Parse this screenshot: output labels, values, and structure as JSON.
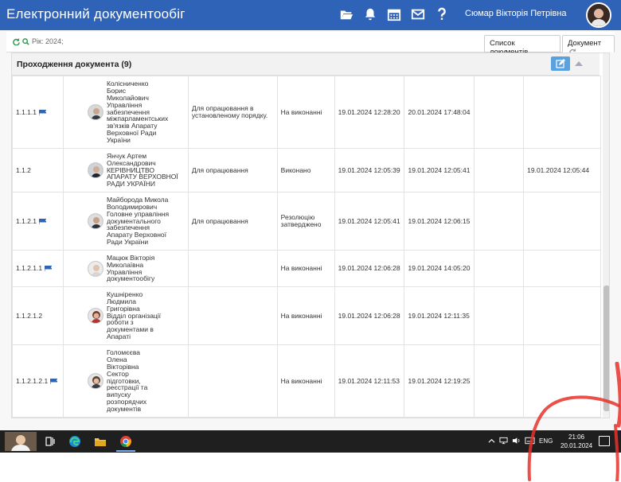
{
  "app": {
    "title": "Електронний документообіг",
    "user_name": "Сюмар Вікторія Петрівна",
    "icons": [
      "folder-open-icon",
      "bell-icon",
      "calendar-icon",
      "envelope-icon",
      "question-icon"
    ]
  },
  "toolbar": {
    "year_filter": "Рік: 2024;",
    "tabs": [
      {
        "label": "Список документів"
      },
      {
        "label": "Документ"
      }
    ]
  },
  "panel": {
    "title": "Проходження документа (9)",
    "rows": [
      {
        "num": "1.1.1.1",
        "flag": true,
        "person": "Колісниченко\nБорис\nМиколайович\nУправління\nзабезпечення\nміжпарламентських\nзв'язків Апарату\nВерховної Ради\nУкраїни",
        "resolution": "Для опрацювання в установленому порядку.",
        "status": "На виконанні",
        "date1": "19.01.2024 12:28:20",
        "date2": "20.01.2024 17:48:04",
        "date3": "",
        "date4": ""
      },
      {
        "num": "1.1.2",
        "flag": false,
        "person": "Янчук Артем\nОлександрович\nКЕРІВНИЦТВО\nАПАРАТУ ВЕРХОВНОЇ\nРАДИ УКРАЇНИ",
        "resolution": "Для опрацювання",
        "status": "Виконано",
        "date1": "19.01.2024 12:05:39",
        "date2": "19.01.2024 12:05:41",
        "date3": "",
        "date4": "19.01.2024 12:05:44"
      },
      {
        "num": "1.1.2.1",
        "flag": true,
        "person": "Майборода Микола\nВолодимирович\nГоловне управління\nдокументального\nзабезпечення\nАпарату Верховної\nРади України",
        "resolution": "Для опрацювання",
        "status": "Резолюцію затверджено",
        "date1": "19.01.2024 12:05:41",
        "date2": "19.01.2024 12:06:15",
        "date3": "",
        "date4": ""
      },
      {
        "num": "1.1.2.1.1",
        "flag": true,
        "person": "Мацюк Вікторія\nМиколаївна\nУправління\nдокументообігу",
        "resolution": "",
        "status": "На виконанні",
        "date1": "19.01.2024 12:06:28",
        "date2": "19.01.2024 14:05:20",
        "date3": "",
        "date4": ""
      },
      {
        "num": "1.1.2.1.2",
        "flag": false,
        "person": "Кушніренко\nЛюдмила\nГригорівна\nВідділ організації\nроботи з\nдокументами в\nАпараті",
        "resolution": "",
        "status": "На виконанні",
        "date1": "19.01.2024 12:06:28",
        "date2": "19.01.2024 12:11:35",
        "date3": "",
        "date4": ""
      },
      {
        "num": "1.1.2.1.2.1",
        "flag": true,
        "person": "Голомєєва\nОлена\nВікторівна\nСектор\nпідготовки,\nреєстрації та\nвипуску\nрозпорядчих\nдокументів",
        "resolution": "",
        "status": "На виконанні",
        "date1": "19.01.2024 12:11:53",
        "date2": "19.01.2024 12:19:25",
        "date3": "",
        "date4": ""
      }
    ]
  },
  "taskbar": {
    "language": "ENG",
    "time": "21:06",
    "date": "20.01.2024"
  },
  "colors": {
    "topbar": "#2f63b7",
    "edit_button": "#5aa1e0",
    "flag": "#2f63b7",
    "taskbar": "#1f1f1f",
    "annotation": "#e5332a"
  }
}
